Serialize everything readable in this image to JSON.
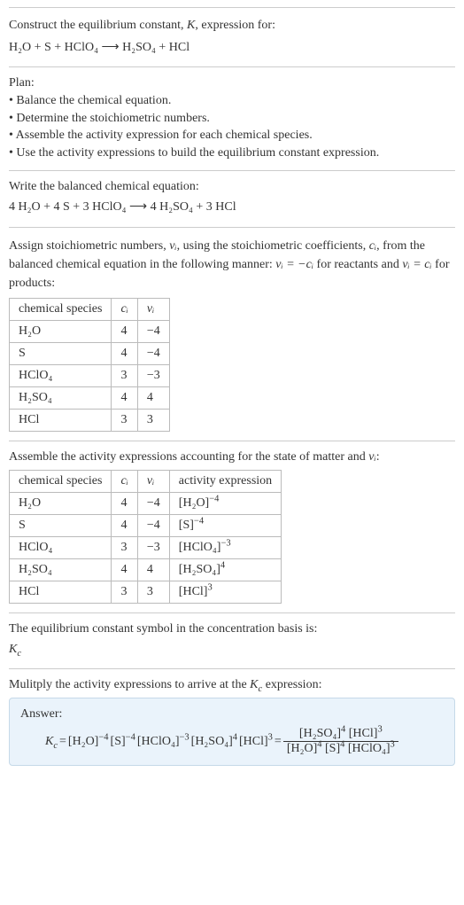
{
  "intro": {
    "line1": "Construct the equilibrium constant, K, expression for:",
    "eqn": "H₂O + S + HClO₄ ⟶ H₂SO₄ + HCl"
  },
  "plan": {
    "head": "Plan:",
    "items": [
      "• Balance the chemical equation.",
      "• Determine the stoichiometric numbers.",
      "• Assemble the activity expression for each chemical species.",
      "• Use the activity expressions to build the equilibrium constant expression."
    ]
  },
  "balanced": {
    "head": "Write the balanced chemical equation:",
    "eqn": "4 H₂O + 4 S + 3 HClO₄ ⟶ 4 H₂SO₄ + 3 HCl"
  },
  "stoich": {
    "head_a": "Assign stoichiometric numbers, ",
    "head_b": ", using the stoichiometric coefficients, ",
    "head_c": ", from the balanced chemical equation in the following manner: ",
    "head_d": " for reactants and ",
    "head_e": " for products:",
    "nu": "νᵢ",
    "ci": "cᵢ",
    "nu_eq_neg": "νᵢ = −cᵢ",
    "nu_eq_pos": "νᵢ = cᵢ",
    "cols": {
      "c1": "chemical species",
      "c2": "cᵢ",
      "c3": "νᵢ"
    },
    "rows": [
      {
        "sp": "H₂O",
        "c": "4",
        "v": "−4"
      },
      {
        "sp": "S",
        "c": "4",
        "v": "−4"
      },
      {
        "sp": "HClO₄",
        "c": "3",
        "v": "−3"
      },
      {
        "sp": "H₂SO₄",
        "c": "4",
        "v": "4"
      },
      {
        "sp": "HCl",
        "c": "3",
        "v": "3"
      }
    ]
  },
  "activity": {
    "head_a": "Assemble the activity expressions accounting for the state of matter and ",
    "head_b": ":",
    "nu": "νᵢ",
    "cols": {
      "c1": "chemical species",
      "c2": "cᵢ",
      "c3": "νᵢ",
      "c4": "activity expression"
    },
    "rows": [
      {
        "sp": "H₂O",
        "c": "4",
        "v": "−4",
        "a_base": "[H₂O]",
        "a_exp": "−4"
      },
      {
        "sp": "S",
        "c": "4",
        "v": "−4",
        "a_base": "[S]",
        "a_exp": "−4"
      },
      {
        "sp": "HClO₄",
        "c": "3",
        "v": "−3",
        "a_base": "[HClO₄]",
        "a_exp": "−3"
      },
      {
        "sp": "H₂SO₄",
        "c": "4",
        "v": "4",
        "a_base": "[H₂SO₄]",
        "a_exp": "4"
      },
      {
        "sp": "HCl",
        "c": "3",
        "v": "3",
        "a_base": "[HCl]",
        "a_exp": "3"
      }
    ]
  },
  "ksym": {
    "head": "The equilibrium constant symbol in the concentration basis is:",
    "val_base": "K",
    "val_sub": "c"
  },
  "mult": {
    "head_a": "Mulitply the activity expressions to arrive at the ",
    "head_b": " expression:",
    "kc_base": "K",
    "kc_sub": "c"
  },
  "answer": {
    "label": "Answer:",
    "lhs_base": "K",
    "lhs_sub": "c",
    "eq": " = ",
    "terms": [
      {
        "b": "[H₂O]",
        "e": "−4"
      },
      {
        "b": "[S]",
        "e": "−4"
      },
      {
        "b": "[HClO₄]",
        "e": "−3"
      },
      {
        "b": "[H₂SO₄]",
        "e": "4"
      },
      {
        "b": "[HCl]",
        "e": "3"
      }
    ],
    "eq2": " = ",
    "frac_num": [
      {
        "b": "[H₂SO₄]",
        "e": "4"
      },
      {
        "b": "[HCl]",
        "e": "3"
      }
    ],
    "frac_den": [
      {
        "b": "[H₂O]",
        "e": "4"
      },
      {
        "b": "[S]",
        "e": "4"
      },
      {
        "b": "[HClO₄]",
        "e": "3"
      }
    ]
  }
}
